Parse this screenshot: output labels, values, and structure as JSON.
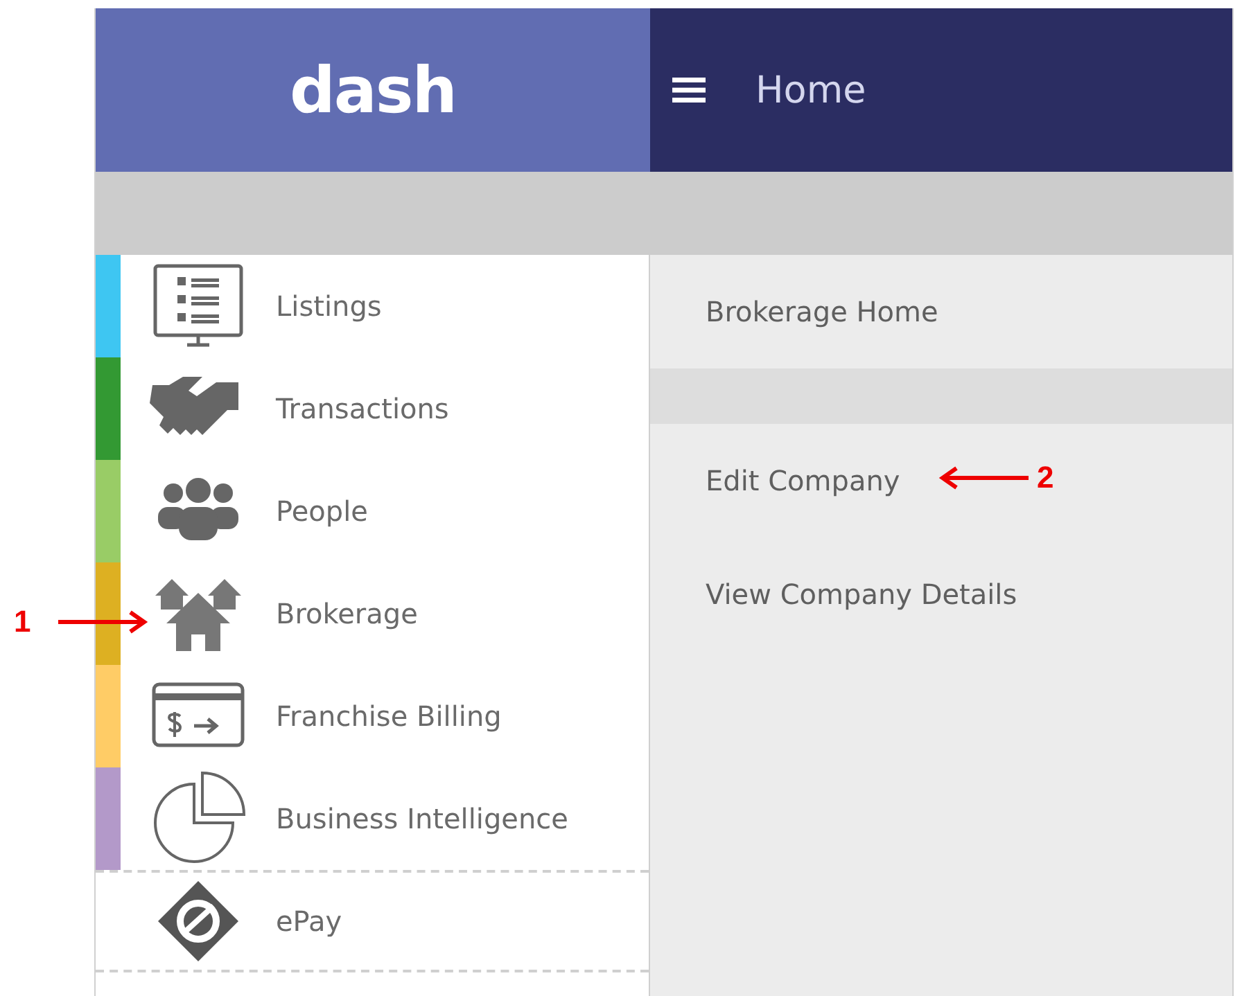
{
  "header": {
    "logo": "dash",
    "title": "Home"
  },
  "sidebar": {
    "items": [
      {
        "label": "Listings",
        "kind": "category",
        "color": "#3ec6f2"
      },
      {
        "label": "Transactions",
        "kind": "category",
        "color": "#339933"
      },
      {
        "label": "People",
        "kind": "category",
        "color": "#99cc66"
      },
      {
        "label": "Brokerage",
        "kind": "category",
        "color": "#ddb022"
      },
      {
        "label": "Franchise Billing",
        "kind": "category",
        "color": "#ffcc66"
      },
      {
        "label": "Business Intelligence",
        "kind": "category",
        "color": "#b399c9"
      },
      {
        "label": "ePay",
        "kind": "external"
      }
    ]
  },
  "submenu": {
    "groups": [
      [
        "Brokerage Home"
      ],
      [
        "Edit Company",
        "View Company Details"
      ]
    ]
  },
  "annotations": [
    {
      "label": "1",
      "kind": "right-arrow"
    },
    {
      "label": "2",
      "kind": "left-arrow"
    }
  ]
}
